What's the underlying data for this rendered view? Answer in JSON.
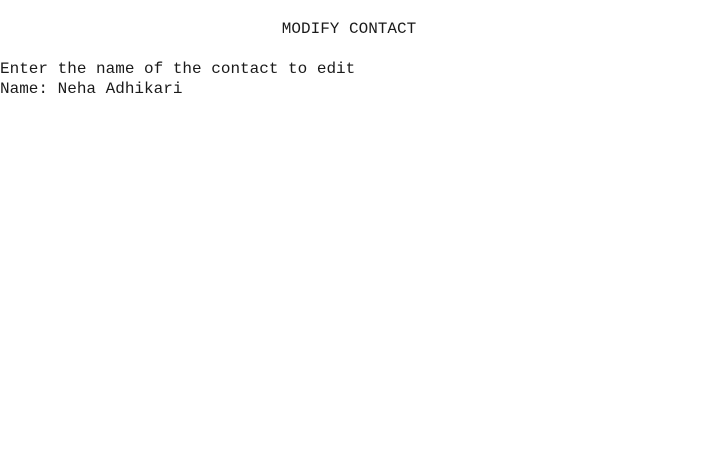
{
  "console": {
    "title": "MODIFY CONTACT",
    "prompt": "Enter the name of the contact to edit",
    "name_label": "Name: ",
    "name_value": "Neha Adhikari"
  }
}
